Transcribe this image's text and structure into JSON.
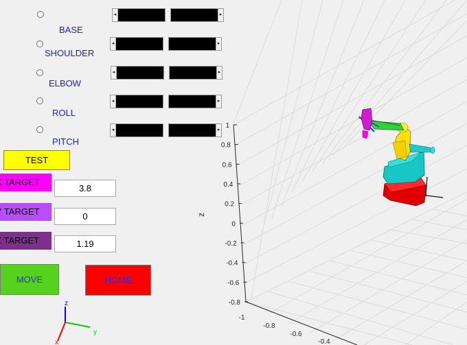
{
  "joints": [
    {
      "label": "BASE"
    },
    {
      "label": "SHOULDER"
    },
    {
      "label": "ELBOW"
    },
    {
      "label": "ROLL"
    },
    {
      "label": "PITCH"
    }
  ],
  "buttons": {
    "test_label": "TEST",
    "move_label": "MOVE",
    "home_label": "HOME"
  },
  "targets": [
    {
      "label": "X TARGET",
      "value": "3.8",
      "color": "#ff00ff"
    },
    {
      "label": "Y TARGET",
      "value": "0",
      "color": "#b84dff"
    },
    {
      "label": "Z TARGET",
      "value": "1.19",
      "color": "#7e2e8c"
    }
  ],
  "colors": {
    "test": "#ffff00",
    "move": "#56d11d",
    "home": "#ff0000",
    "move_text": "#2c2ce0",
    "home_text": "#2c2ce0",
    "joint_text": "#1e22c8"
  },
  "plot": {
    "z_axis_label": "z",
    "z_ticks": [
      "1",
      "0.8",
      "0.6",
      "0.4",
      "0.2",
      "0",
      "-0.2",
      "-0.4",
      "-0.6",
      "-0.8"
    ],
    "x_ticks": [
      "-1",
      "-0.8",
      "-0.6",
      "-0.4"
    ]
  },
  "triad": {
    "x_label": "x",
    "y_label": "y",
    "z_label": "z"
  }
}
